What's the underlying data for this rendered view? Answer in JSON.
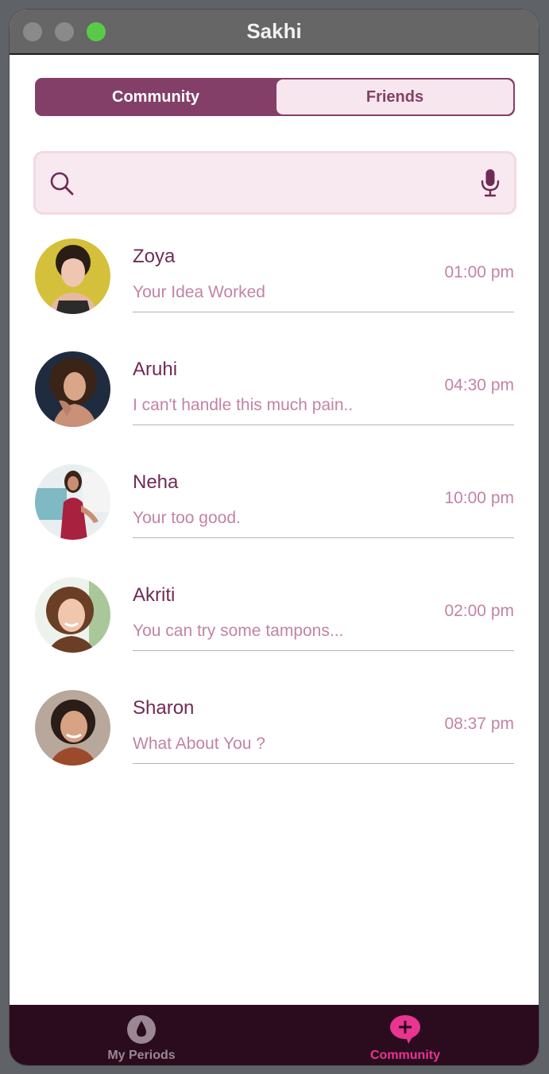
{
  "window": {
    "title": "Sakhi"
  },
  "segmented": {
    "community_label": "Community",
    "friends_label": "Friends",
    "selected": "Community"
  },
  "search": {
    "placeholder": "",
    "value": ""
  },
  "chats": [
    {
      "name": "Zoya",
      "preview": "Your Idea Worked",
      "time": "01:00 pm"
    },
    {
      "name": "Aruhi",
      "preview": "I can't handle this much pain..",
      "time": "04:30 pm"
    },
    {
      "name": "Neha",
      "preview": "Your too good.",
      "time": "10:00 pm"
    },
    {
      "name": "Akriti",
      "preview": "You can try some tampons...",
      "time": "02:00 pm"
    },
    {
      "name": "Sharon",
      "preview": "What About You ?",
      "time": "08:37 pm"
    }
  ],
  "tabbar": {
    "periods_label": "My Periods",
    "community_label": "Community",
    "selected": "Community"
  },
  "colors": {
    "accent": "#843f68",
    "accent_light": "#f8e6ee",
    "name_text": "#6f2a55",
    "secondary_text": "#c383a4",
    "tabbar_bg": "#2b0c1f",
    "active_tab": "#e9358f",
    "inactive_tab": "#9a8793"
  },
  "icons": {
    "search": "search-icon",
    "mic": "microphone-icon",
    "periods_tab": "blood-drop-icon",
    "community_tab": "chat-bubble-plus-icon"
  }
}
